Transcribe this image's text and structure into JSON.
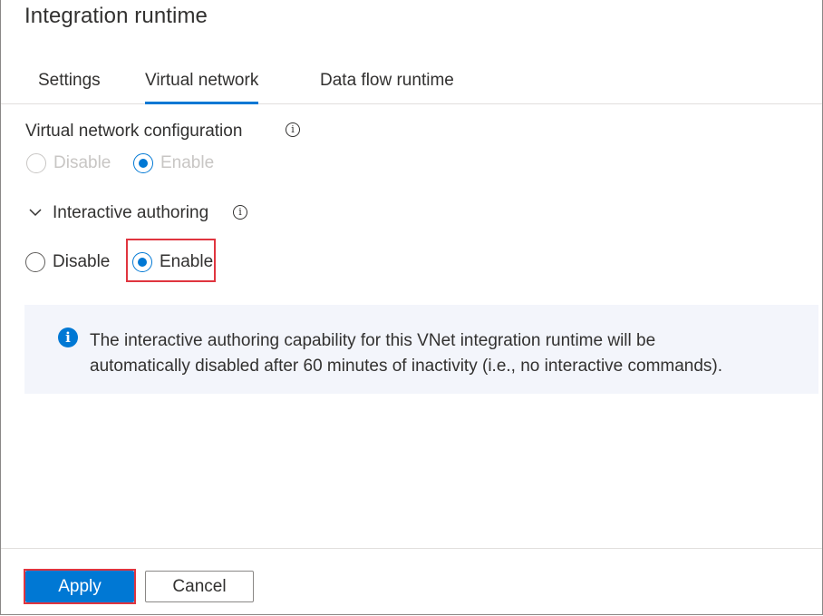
{
  "dialog": {
    "title": "Integration runtime"
  },
  "tabs": [
    {
      "label": "Settings",
      "active": false
    },
    {
      "label": "Virtual network",
      "active": true
    },
    {
      "label": "Data flow runtime",
      "active": false
    }
  ],
  "vnet_config": {
    "label": "Virtual network configuration",
    "info_icon": "info-icon",
    "options": [
      {
        "label": "Disable",
        "selected": false,
        "disabled": true
      },
      {
        "label": "Enable",
        "selected": true,
        "disabled": true
      }
    ]
  },
  "interactive_authoring": {
    "label": "Interactive authoring",
    "expanded": true,
    "info_icon": "info-icon",
    "options": [
      {
        "label": "Disable",
        "selected": false
      },
      {
        "label": "Enable",
        "selected": true
      }
    ]
  },
  "info_message": {
    "icon": "info-filled-icon",
    "line1": "The interactive authoring capability for this VNet integration runtime will be",
    "line2": "automatically disabled after 60 minutes of inactivity (i.e., no interactive commands)."
  },
  "footer": {
    "apply_label": "Apply",
    "cancel_label": "Cancel"
  },
  "colors": {
    "accent": "#0078d4",
    "highlight": "#e0353f",
    "info_background": "#f3f5fb"
  }
}
